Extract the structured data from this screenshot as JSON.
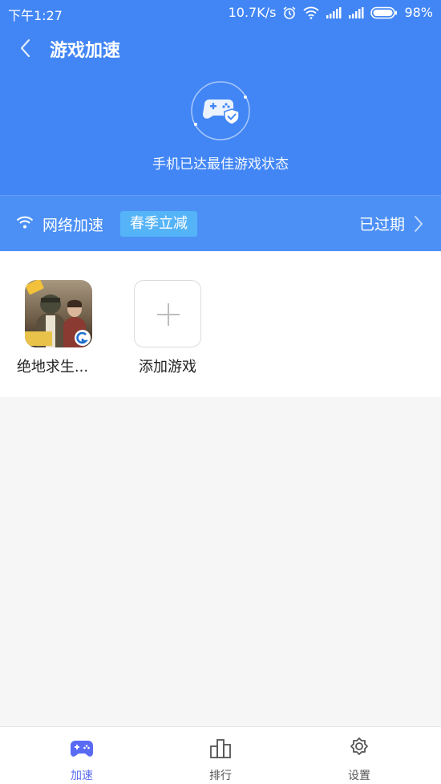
{
  "status_bar": {
    "time": "下午1:27",
    "speed": "10.7K/s",
    "battery": "98%"
  },
  "header": {
    "title": "游戏加速"
  },
  "hero": {
    "status_text": "手机已达最佳游戏状态"
  },
  "network_bar": {
    "label": "网络加速",
    "promo": "春季立减",
    "status": "已过期"
  },
  "games": [
    {
      "name": "绝地求生...",
      "icon": "pubg-game-icon"
    },
    {
      "name": "添加游戏",
      "icon": "add-icon"
    }
  ],
  "tabs": [
    {
      "label": "加速",
      "icon": "gamepad-icon",
      "active": true
    },
    {
      "label": "排行",
      "icon": "ranking-icon",
      "active": false
    },
    {
      "label": "设置",
      "icon": "settings-icon",
      "active": false
    }
  ],
  "colors": {
    "header_blue": "#4286f5",
    "promo_blue": "#55b3f8",
    "tab_active": "#5a6bf3"
  }
}
